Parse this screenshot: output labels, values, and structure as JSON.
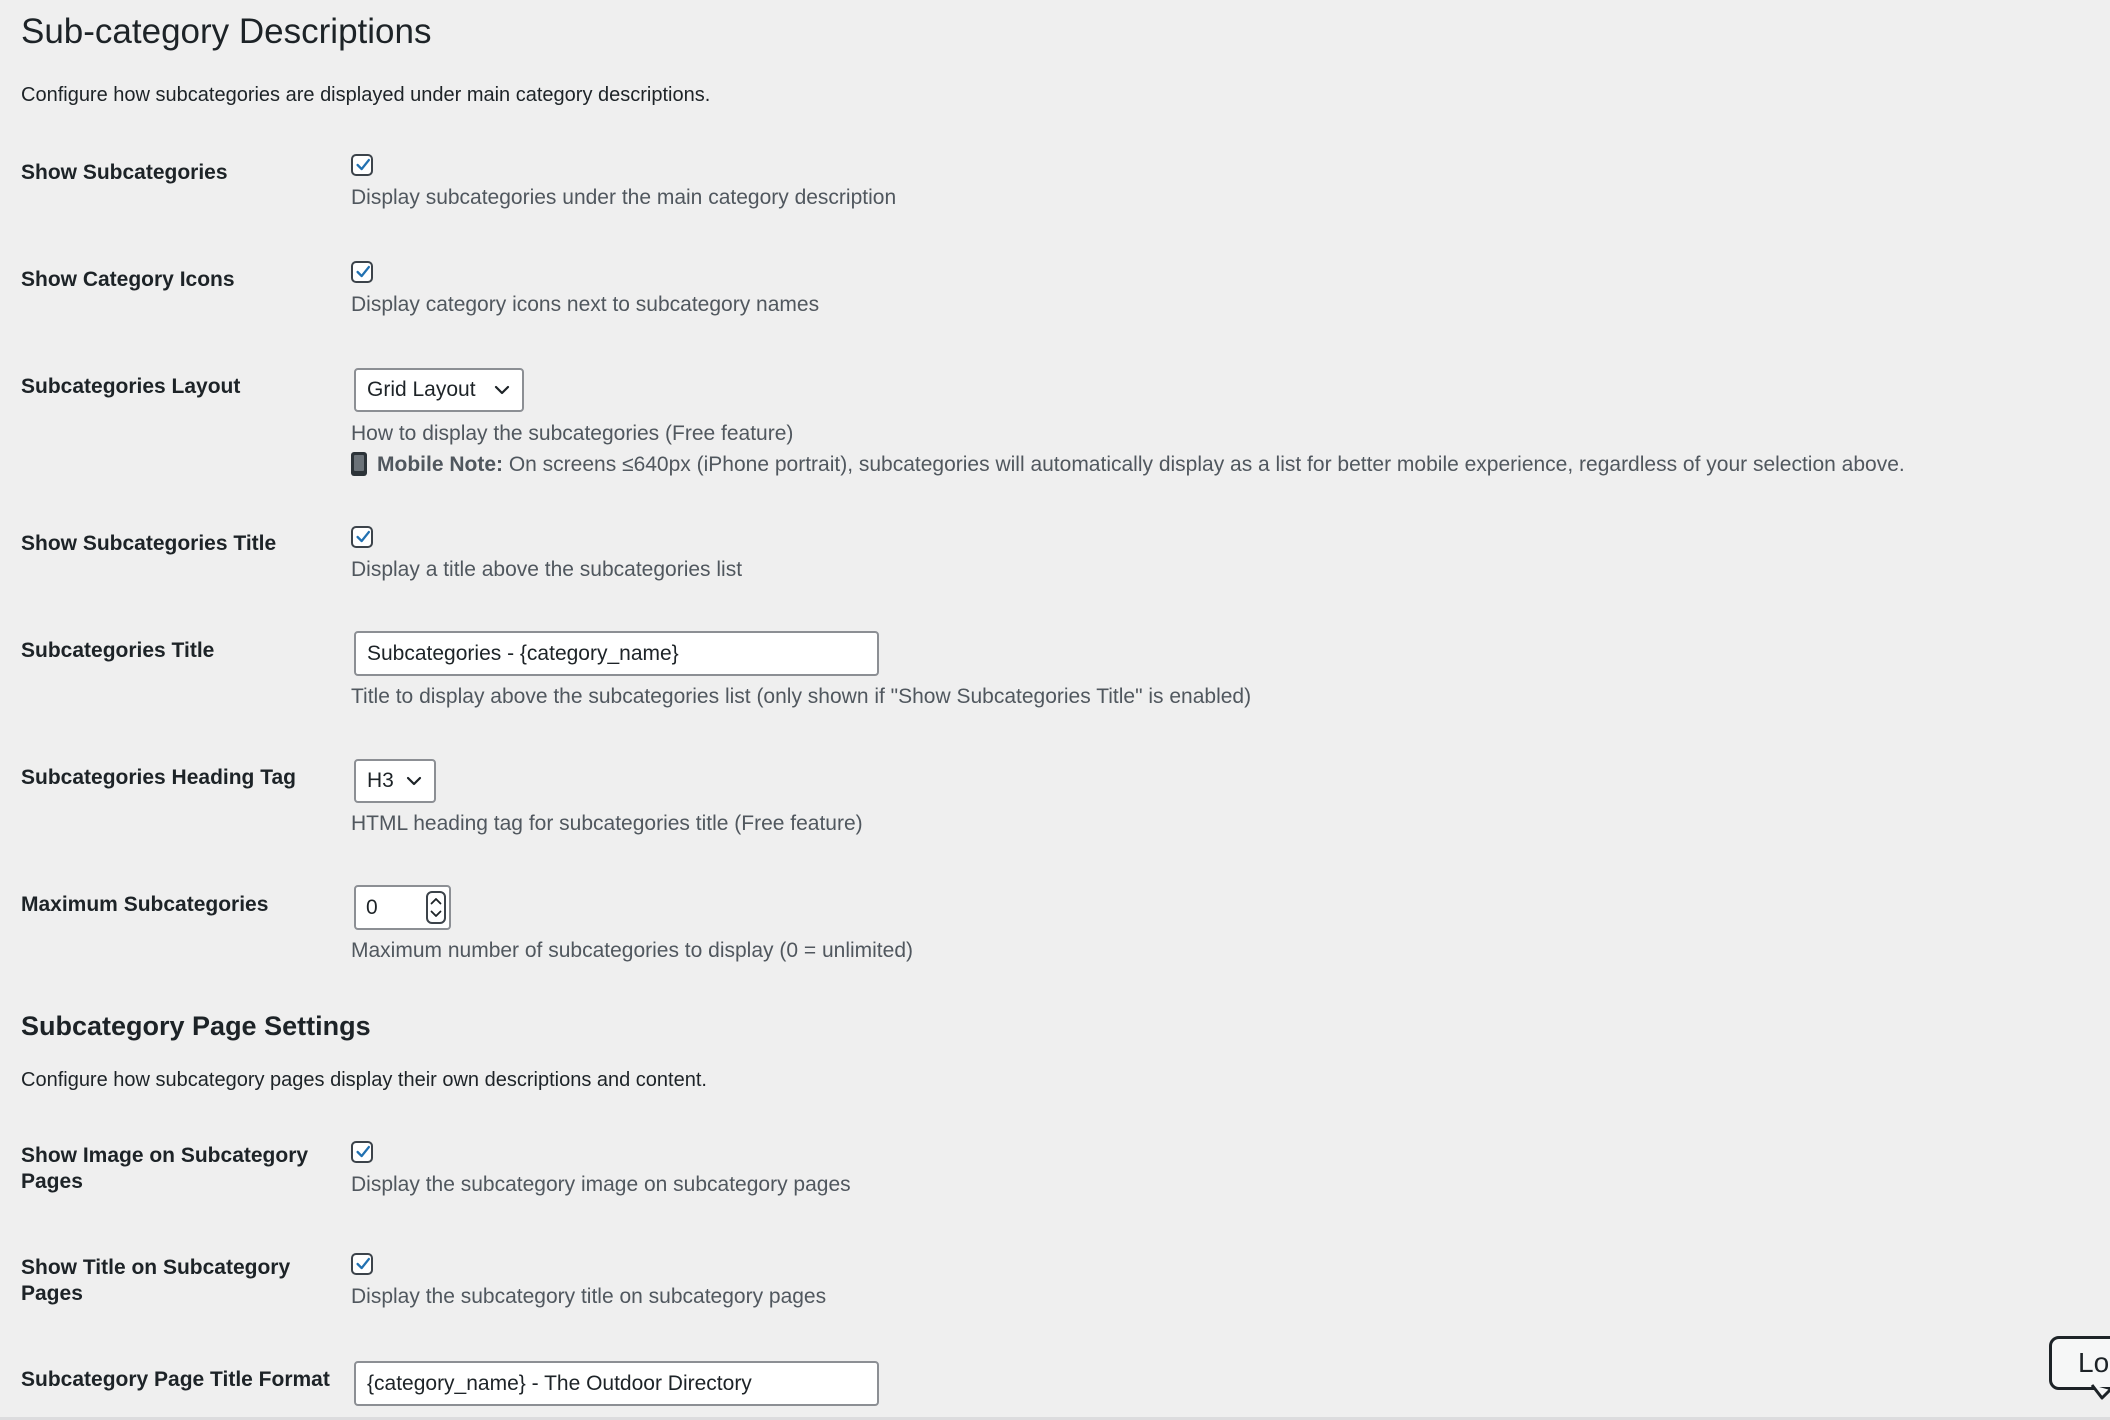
{
  "page_title": "Sub-category Descriptions",
  "intro": "Configure how subcategories are displayed under main category descriptions.",
  "settings": [
    {
      "label": "Show Subcategories",
      "checked": true,
      "description": "Display subcategories under the main category description"
    },
    {
      "label": "Show Category Icons",
      "checked": true,
      "description": "Display category icons next to subcategory names"
    },
    {
      "label": "Subcategories Layout",
      "select_value": "Grid Layout",
      "description": "How to display the subcategories (Free feature)",
      "note_label": "Mobile Note:",
      "note_text": " On screens ≤640px (iPhone portrait), subcategories will automatically display as a list for better mobile experience, regardless of your selection above."
    },
    {
      "label": "Show Subcategories Title",
      "checked": true,
      "description": "Display a title above the subcategories list"
    },
    {
      "label": "Subcategories Title",
      "input_value": "Subcategories - {category_name}",
      "description": "Title to display above the subcategories list (only shown if \"Show Subcategories Title\" is enabled)"
    },
    {
      "label": "Subcategories Heading Tag",
      "select_value": "H3",
      "description": "HTML heading tag for subcategories title (Free feature)"
    },
    {
      "label": "Maximum Subcategories",
      "number_value": "0",
      "description": "Maximum number of subcategories to display (0 = unlimited)"
    }
  ],
  "page_settings": {
    "heading": "Subcategory Page Settings",
    "intro": "Configure how subcategory pages display their own descriptions and content.",
    "items": [
      {
        "label": "Show Image on Subcategory Pages",
        "checked": true,
        "description": "Display the subcategory image on subcategory pages"
      },
      {
        "label": "Show Title on Subcategory Pages",
        "checked": true,
        "description": "Display the subcategory title on subcategory pages"
      },
      {
        "label": "Subcategory Page Title Format",
        "input_value": "{category_name} - The Outdoor Directory"
      }
    ]
  },
  "login_button": "Log",
  "icons": {
    "checkmark": "checkmark-icon",
    "dropdown": "chevron-down-icon",
    "spinner": "number-spinner-icon",
    "phone": "mobile-phone-icon"
  },
  "colors": {
    "background": "#efefef",
    "checkmark": "#2271b1",
    "text": "#1d2327",
    "muted_text": "#50575e",
    "input_border": "#8c8f94"
  }
}
